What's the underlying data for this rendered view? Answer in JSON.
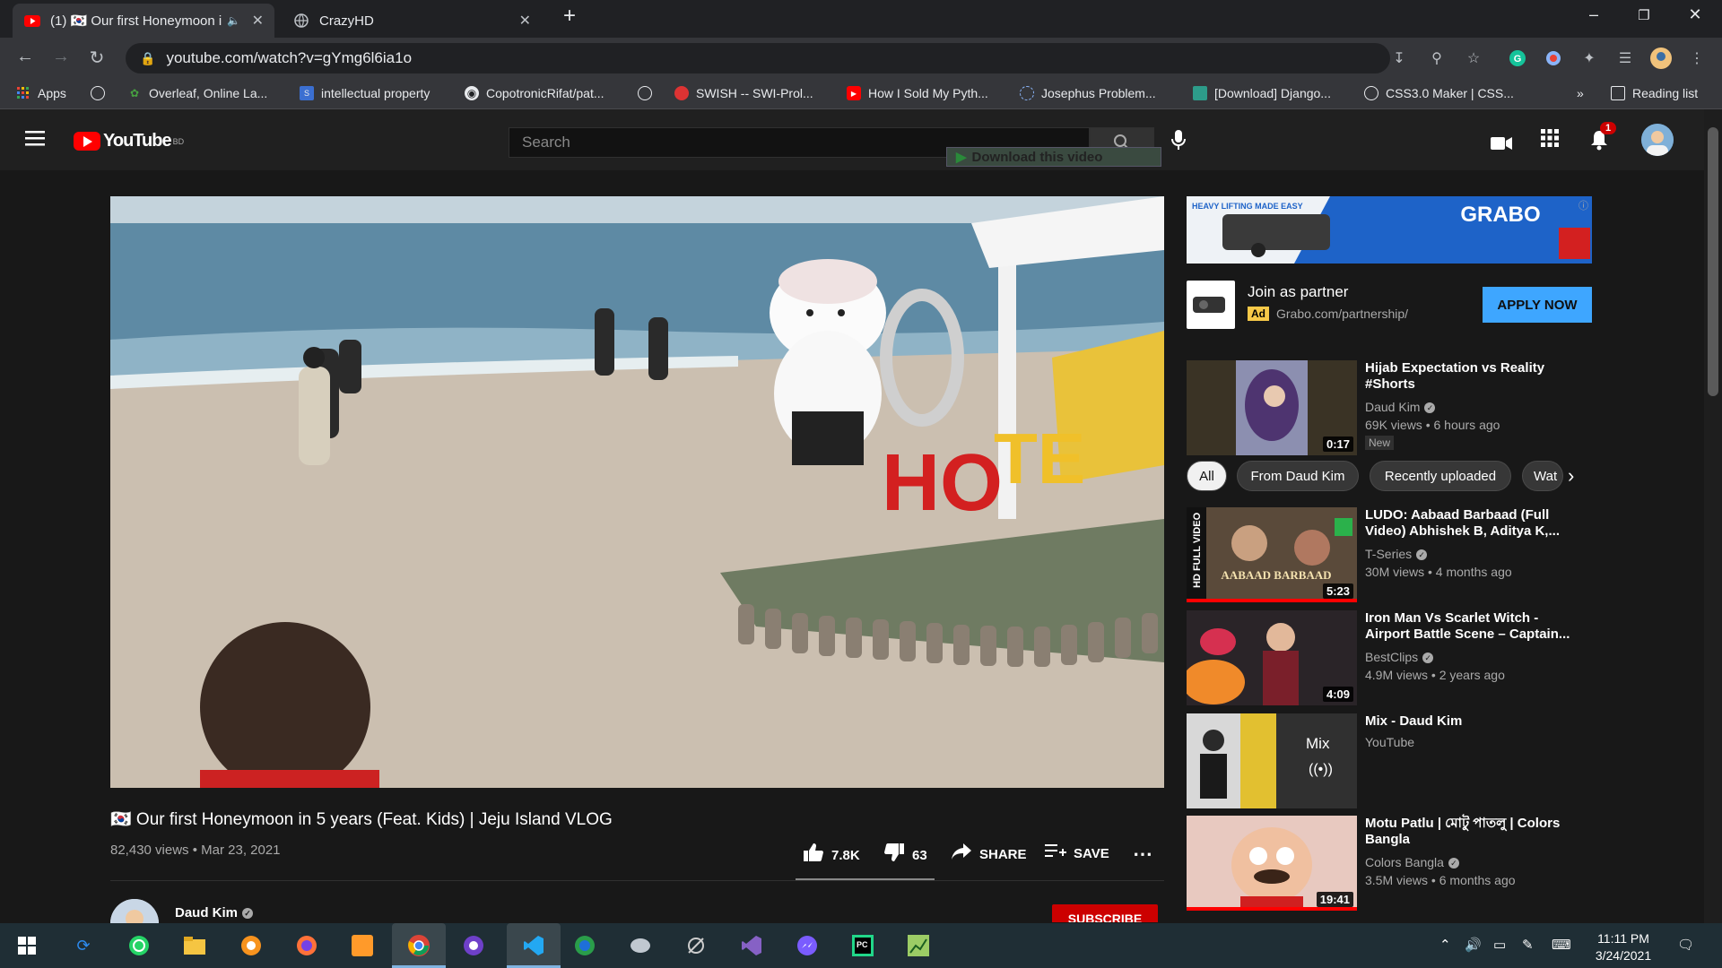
{
  "browser": {
    "tabs": [
      {
        "title": "(1) 🇰🇷 Our first Honeymoon i",
        "active": true
      },
      {
        "title": "CrazyHD",
        "active": false
      }
    ],
    "url": "youtube.com/watch?v=gYmg6l6ia1o",
    "bookmarks": [
      "Apps",
      "Overleaf, Online La...",
      "intellectual property",
      "CopotronicRifat/pat...",
      "SWISH -- SWI-Prol...",
      "How I Sold My Pyth...",
      "Josephus Problem...",
      "[Download] Django...",
      "CSS3.0 Maker | CSS..."
    ],
    "bookmarks_more": "»",
    "reading_list": "Reading list"
  },
  "youtube": {
    "logo_text": "YouTube",
    "country": "BD",
    "search_placeholder": "Search",
    "download_overlay": "Download this video",
    "notification_count": "1"
  },
  "video": {
    "title": "🇰🇷 Our first Honeymoon in 5 years (Feat. Kids) | Jeju Island VLOG",
    "views_date": "82,430 views • Mar 23, 2021",
    "likes": "7.8K",
    "dislikes": "63",
    "share": "SHARE",
    "save": "SAVE",
    "channel": "Daud Kim",
    "subscribe": "SUBSCRIBE"
  },
  "ad": {
    "title": "Join as partner",
    "badge": "Ad",
    "url": "Grabo.com/partnership/",
    "button": "APPLY NOW",
    "banner_text": "GRABO",
    "banner_tagline": "HEAVY LIFTING MADE EASY"
  },
  "chips": [
    "All",
    "From Daud Kim",
    "Recently uploaded",
    "Wat"
  ],
  "recommendations": [
    {
      "title": "Hijab Expectation vs Reality #Shorts",
      "channel": "Daud Kim",
      "meta": "69K views • 6 hours ago",
      "duration": "0:17",
      "badge": "New"
    },
    {
      "title": "LUDO: Aabaad Barbaad (Full Video) Abhishek B, Aditya K,...",
      "channel": "T-Series",
      "meta": "30M views • 4 months ago",
      "duration": "5:23",
      "thumb_text": "AABAAD BARBAAD",
      "side_text": "HD FULL VIDEO"
    },
    {
      "title": "Iron Man Vs Scarlet Witch - Airport Battle Scene – Captain...",
      "channel": "BestClips",
      "meta": "4.9M views • 2 years ago",
      "duration": "4:09"
    },
    {
      "title": "Mix - Daud Kim",
      "channel": "YouTube",
      "meta": "",
      "duration": "",
      "mix_label": "Mix"
    },
    {
      "title": "Motu Patlu | মোটু পাতলু | Colors Bangla",
      "channel": "Colors Bangla",
      "meta": "3.5M views • 6 months ago",
      "duration": "19:41"
    }
  ],
  "taskbar": {
    "time": "11:11 PM",
    "date": "3/24/2021"
  },
  "colors": {
    "youtube_red": "#ff0000",
    "apply_blue": "#3ea6ff",
    "subscribe_red": "#cc0000",
    "ad_yellow": "#f7c948"
  }
}
